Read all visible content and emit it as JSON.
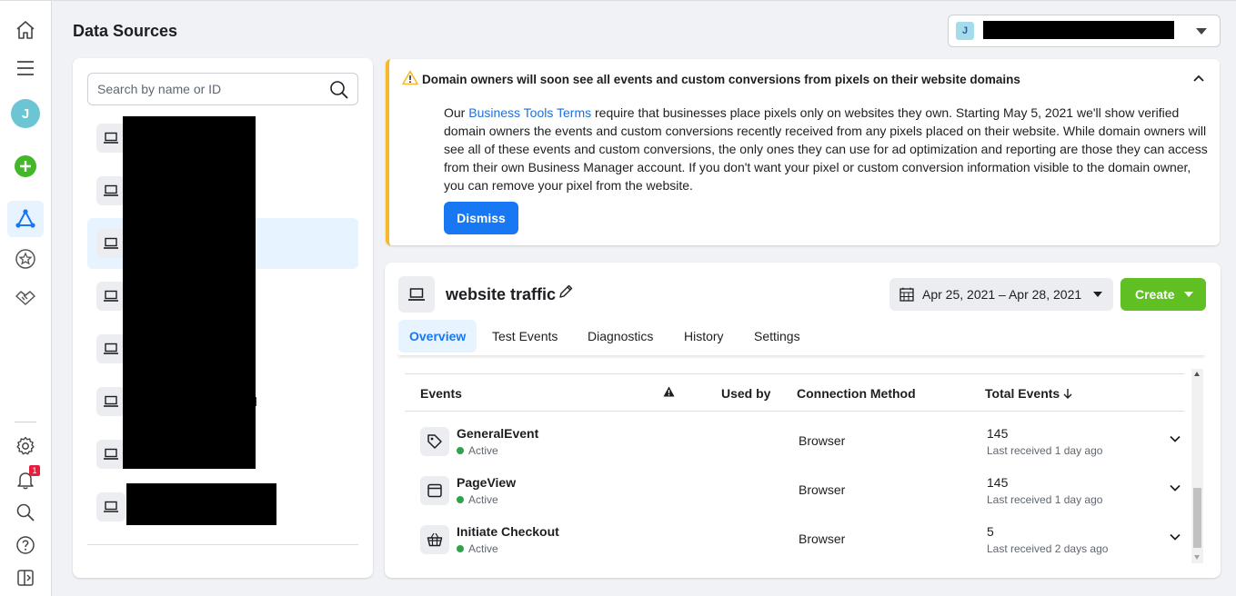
{
  "page": {
    "title": "Data Sources"
  },
  "account": {
    "initial": "J"
  },
  "rail": {
    "avatar_initial": "J",
    "notification_count": "1",
    "icons": [
      "home-icon",
      "menu-icon",
      "profile-avatar",
      "create-icon",
      "events-manager-icon",
      "star-icon",
      "partner-icon",
      "settings-icon",
      "notifications-icon",
      "search-icon",
      "help-icon",
      "panel-toggle-icon"
    ]
  },
  "list": {
    "search_placeholder": "Search by name or ID",
    "partial_label": "el",
    "item_count": 8,
    "selected_index": 2
  },
  "banner": {
    "title": "Domain owners will soon see all events and custom conversions from pixels on their website domains",
    "body_prefix": "Our ",
    "body_link": "Business Tools Terms",
    "body_text": " require that businesses place pixels only on websites they own. Starting May 5, 2021 we'll show verified domain owners the events and custom conversions recently received from any pixels placed on their website. While domain owners will see all of these events and custom conversions, the only ones they can use for ad optimization and reporting are those they can access from their own Business Manager account. If you don't want your pixel or custom conversion information visible to the domain owner, you can remove your pixel from the website.",
    "dismiss_label": "Dismiss",
    "accent_color": "#f7b928"
  },
  "detail": {
    "title": "website traffic",
    "date_range": "Apr 25, 2021 – Apr 28, 2021",
    "create_label": "Create",
    "create_color": "#5fbf23",
    "tabs": [
      {
        "label": "Overview",
        "active": true
      },
      {
        "label": "Test Events",
        "active": false
      },
      {
        "label": "Diagnostics",
        "active": false
      },
      {
        "label": "History",
        "active": false
      },
      {
        "label": "Settings",
        "active": false
      }
    ],
    "table": {
      "headers": {
        "events": "Events",
        "warning_icon": "warning-icon",
        "used_by": "Used by",
        "connection_method": "Connection Method",
        "total_events": "Total Events"
      },
      "rows": [
        {
          "name": "GeneralEvent",
          "status": "Active",
          "icon": "tag-icon",
          "connection": "Browser",
          "total": "145",
          "last": "Last received 1 day ago"
        },
        {
          "name": "PageView",
          "status": "Active",
          "icon": "browser-window-icon",
          "connection": "Browser",
          "total": "145",
          "last": "Last received 1 day ago"
        },
        {
          "name": "Initiate Checkout",
          "status": "Active",
          "icon": "basket-icon",
          "connection": "Browser",
          "total": "5",
          "last": "Last received 2 days ago"
        }
      ]
    }
  }
}
